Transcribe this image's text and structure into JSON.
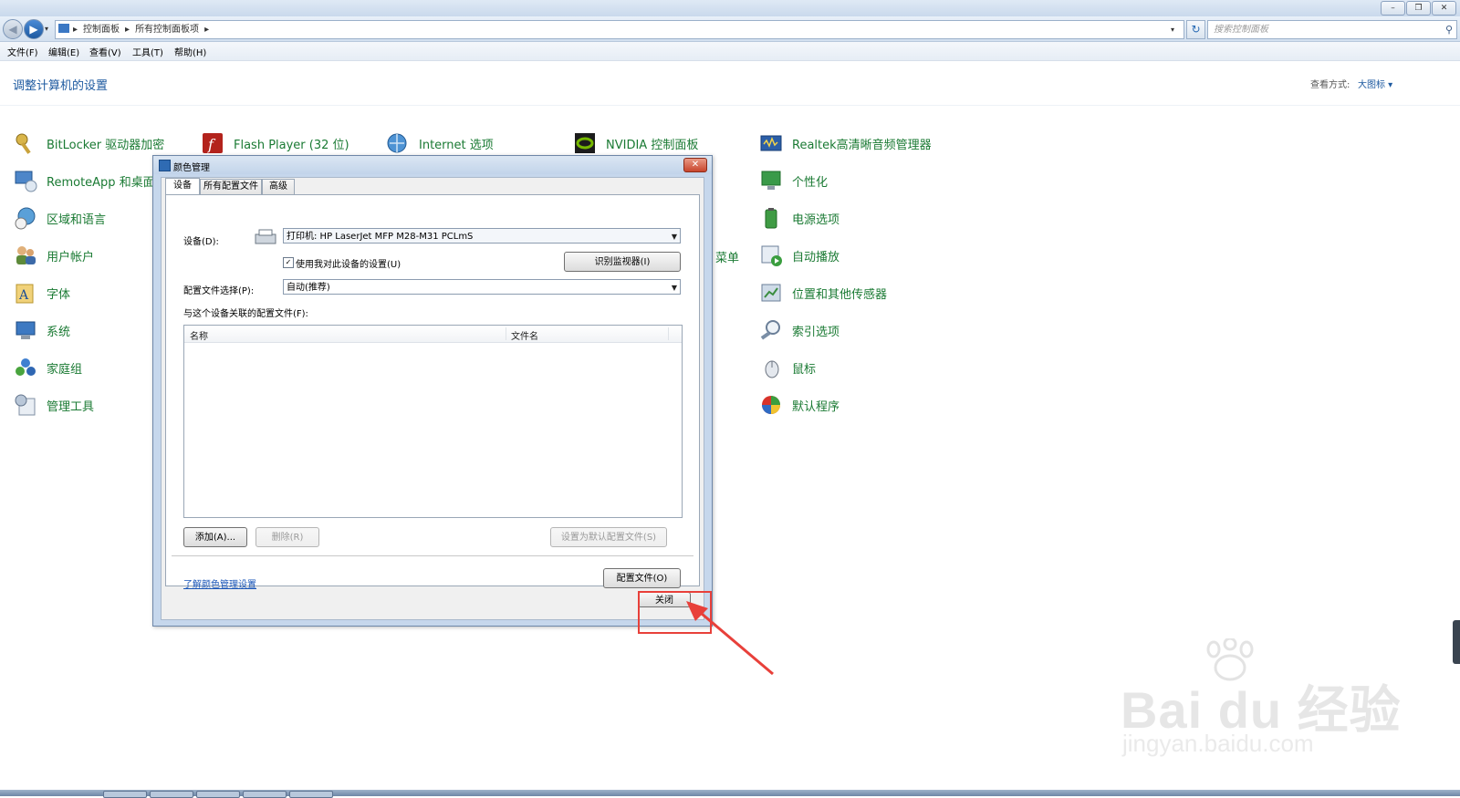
{
  "window": {
    "min_label": "–",
    "max_label": "❐",
    "close_label": "✕"
  },
  "address": {
    "crumb1": "控制面板",
    "crumb2": "所有控制面板项",
    "sep": "▸",
    "search_placeholder": "搜索控制面板"
  },
  "menu": {
    "file": "文件(F)",
    "edit": "编辑(E)",
    "view": "查看(V)",
    "tools": "工具(T)",
    "help": "帮助(H)"
  },
  "content": {
    "title": "调整计算机的设置",
    "view_by_label": "查看方式:",
    "view_by_value": "大图标 ▾",
    "items": {
      "bitlocker": "BitLocker 驱动器加密",
      "remoteapp": "RemoteApp 和桌面",
      "region": "区域和语言",
      "users": "用户帐户",
      "fonts": "字体",
      "system": "系统",
      "homegroup": "家庭组",
      "admin": "管理工具",
      "flash": "Flash Player (32 位)",
      "internet": "Internet 选项",
      "nvidia": "NVIDIA 控制面板",
      "menu_partial": "菜单",
      "realtek": "Realtek高清晰音频管理器",
      "personalize": "个性化",
      "power": "电源选项",
      "autoplay": "自动播放",
      "location": "位置和其他传感器",
      "indexing": "索引选项",
      "mouse": "鼠标",
      "default_programs": "默认程序"
    }
  },
  "dialog": {
    "title": "颜色管理",
    "tabs": [
      "设备",
      "所有配置文件",
      "高级"
    ],
    "device_label": "设备(D):",
    "device_value": "打印机: HP LaserJet MFP M28-M31 PCLmS",
    "use_my_settings": "使用我对此设备的设置(U)",
    "identify_monitors": "识别监视器(I)",
    "profile_select_label": "配置文件选择(P):",
    "profile_select_value": "自动(推荐)",
    "associated_label": "与这个设备关联的配置文件(F):",
    "col_name": "名称",
    "col_filename": "文件名",
    "add": "添加(A)...",
    "remove": "删除(R)",
    "set_default": "设置为默认配置文件(S)",
    "profiles": "配置文件(O)",
    "learn_link": "了解颜色管理设置",
    "close": "关闭",
    "titlebar_close": "✕"
  },
  "watermark": {
    "brand": "Bai du 经验",
    "url": "jingyan.baidu.com"
  },
  "colors": {
    "link_green": "#1a7a33",
    "title_blue": "#1e5aa0",
    "highlight_red": "#e8403a"
  }
}
